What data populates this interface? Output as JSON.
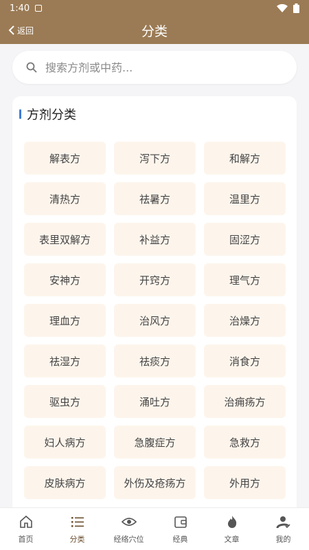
{
  "status_bar": {
    "time": "1:40"
  },
  "header": {
    "back_label": "返回",
    "title": "分类"
  },
  "search": {
    "placeholder": "搜索方剂或中药..."
  },
  "section": {
    "title": "方剂分类"
  },
  "categories": [
    "解表方",
    "泻下方",
    "和解方",
    "清热方",
    "祛暑方",
    "温里方",
    "表里双解方",
    "补益方",
    "固涩方",
    "安神方",
    "开窍方",
    "理气方",
    "理血方",
    "治风方",
    "治燥方",
    "祛湿方",
    "祛痰方",
    "消食方",
    "驱虫方",
    "涌吐方",
    "治痈疡方",
    "妇人病方",
    "急腹症方",
    "急救方",
    "皮肤病方",
    "外伤及疮疡方",
    "外用方"
  ],
  "nav": {
    "items": [
      {
        "label": "首页",
        "icon": "home-icon"
      },
      {
        "label": "分类",
        "icon": "list-icon"
      },
      {
        "label": "经络穴位",
        "icon": "eye-icon"
      },
      {
        "label": "经典",
        "icon": "wallet-icon"
      },
      {
        "label": "文章",
        "icon": "flame-icon"
      },
      {
        "label": "我的",
        "icon": "user-check-icon"
      }
    ],
    "active_index": 1
  },
  "colors": {
    "header_bg": "#9b7b55",
    "tile_bg": "#fdf5ec",
    "accent_bar": "#3e7bd6",
    "active_nav": "#6b4e2e"
  }
}
